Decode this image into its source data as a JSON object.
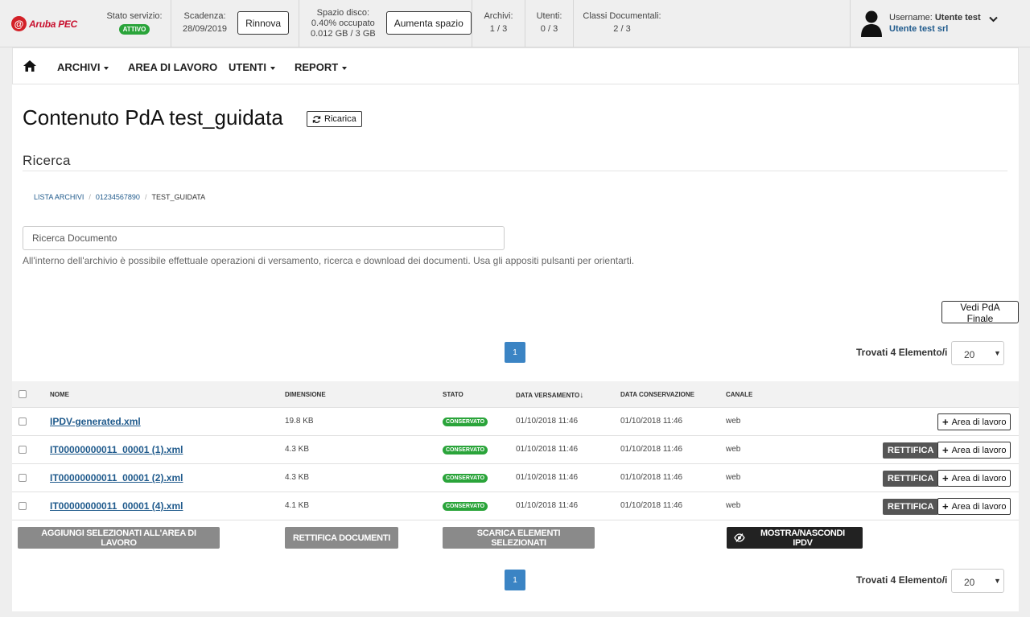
{
  "header": {
    "brand": "Aruba PEC",
    "service": {
      "label": "Stato servizio:",
      "badge": "ATTIVO"
    },
    "expiry": {
      "label": "Scadenza:",
      "value": "28/09/2019",
      "button": "Rinnova"
    },
    "disk": {
      "label": "Spazio disco:",
      "used": "0.40% occupato",
      "amount": "0.012 GB / 3 GB",
      "button": "Aumenta spazio"
    },
    "archives": {
      "label": "Archivi:",
      "value": "1 / 3"
    },
    "users": {
      "label": "Utenti:",
      "value": "0 / 3"
    },
    "classes": {
      "label": "Classi Documentali:",
      "value": "2 / 3"
    },
    "user": {
      "label": "Username:",
      "name": "Utente test",
      "company": "Utente test srl"
    }
  },
  "nav": {
    "items": [
      {
        "label": "ARCHIVI",
        "dropdown": true
      },
      {
        "label": "AREA DI LAVORO",
        "dropdown": false
      },
      {
        "label": "UTENTI",
        "dropdown": true
      },
      {
        "label": "REPORT",
        "dropdown": true
      }
    ]
  },
  "page": {
    "title": "Contenuto PdA test_guidata",
    "reload": "Ricarica",
    "section": "Ricerca",
    "breadcrumb": [
      "LISTA ARCHIVI",
      "01234567890",
      "TEST_GUIDATA"
    ],
    "search_placeholder": "Ricerca Documento",
    "help": "All'interno dell'archivio è possibile effettuale operazioni di versamento, ricerca e download dei documenti. Usa gli appositi pulsanti per orientarti.",
    "final_button": "Vedi PdA Finale"
  },
  "pagination": {
    "current": "1",
    "found": "Trovati 4 Elemento/i",
    "page_size": "20"
  },
  "table": {
    "columns": [
      "NOME",
      "DIMENSIONE",
      "STATO",
      "DATA VERSAMENTO",
      "DATA CONSERVAZIONE",
      "CANALE"
    ],
    "sort_indicator": "↓",
    "rows": [
      {
        "name": "IPDV-generated.xml",
        "size": "19.8 KB",
        "state": "CONSERVATO",
        "date_v": "01/10/2018 11:46",
        "date_c": "01/10/2018 11:46",
        "channel": "web",
        "rettifica": false,
        "area": "Area di lavoro"
      },
      {
        "name": "IT00000000011_00001 (1).xml",
        "size": "4.3 KB",
        "state": "CONSERVATO",
        "date_v": "01/10/2018 11:46",
        "date_c": "01/10/2018 11:46",
        "channel": "web",
        "rettifica": true,
        "rettifica_label": "RETTIFICA",
        "area": "Area di lavoro"
      },
      {
        "name": "IT00000000011_00001 (2).xml",
        "size": "4.3 KB",
        "state": "CONSERVATO",
        "date_v": "01/10/2018 11:46",
        "date_c": "01/10/2018 11:46",
        "channel": "web",
        "rettifica": true,
        "rettifica_label": "RETTIFICA",
        "area": "Area di lavoro"
      },
      {
        "name": "IT00000000011_00001 (4).xml",
        "size": "4.1 KB",
        "state": "CONSERVATO",
        "date_v": "01/10/2018 11:46",
        "date_c": "01/10/2018 11:46",
        "channel": "web",
        "rettifica": true,
        "rettifica_label": "RETTIFICA",
        "area": "Area di lavoro"
      }
    ]
  },
  "actions": {
    "add": "AGGIUNGI SELEZIONATI ALL'AREA DI LAVORO",
    "rettifica": "RETTIFICA DOCUMENTI",
    "download": "SCARICA ELEMENTI SELEZIONATI",
    "toggle": "MOSTRA/NASCONDI IPDV"
  },
  "icons": {
    "home": "home-icon",
    "reload": "refresh-icon",
    "avatar": "user-silhouette-icon",
    "chevron": "chevron-down-icon",
    "eye": "eye-slash-icon",
    "plus": "plus-icon"
  },
  "colors": {
    "accent": "#3b84c4",
    "badge": "#2aa43a",
    "brand": "#c8102e",
    "link": "#1f5a8c",
    "dark_button": "#555555"
  }
}
